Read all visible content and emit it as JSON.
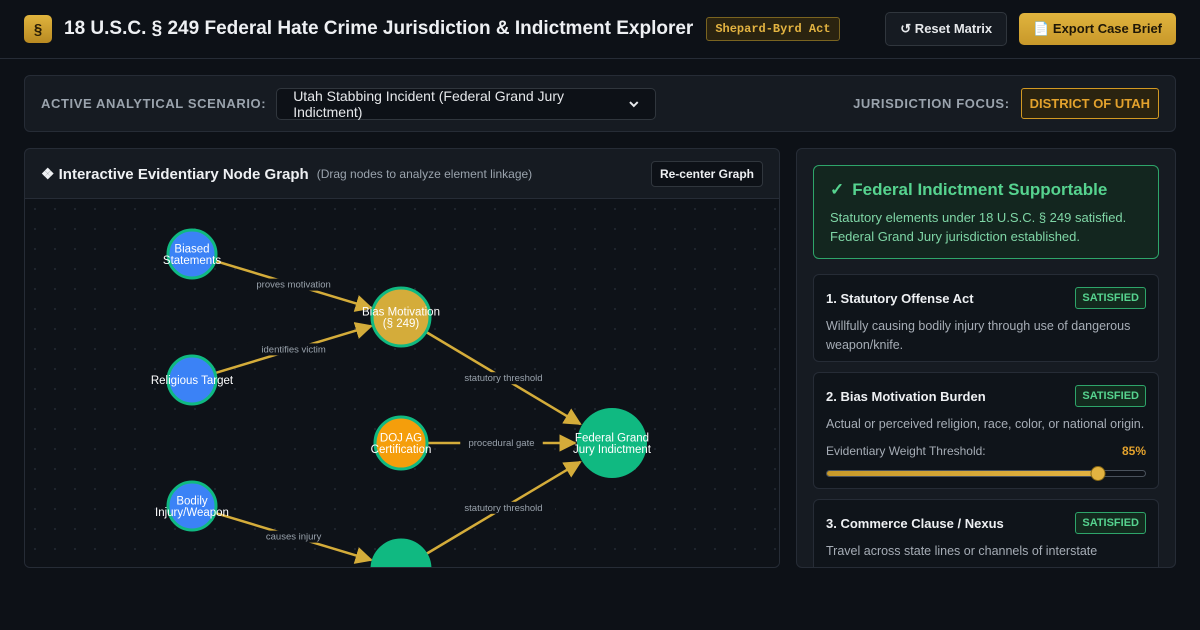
{
  "app": {
    "logo": "§",
    "title": "18 U.S.C. § 249 Federal Hate Crime Jurisdiction & Indictment Explorer",
    "act_badge": "Shepard-Byrd Act"
  },
  "toolbar": {
    "reset_label": "↺ Reset Matrix",
    "export_label": "📄 Export Case Brief"
  },
  "scenario": {
    "label": "ACTIVE ANALYTICAL SCENARIO:",
    "selected": "Utah Stabbing Incident (Federal Grand Jury Indictment)",
    "jurisdiction_label": "JURISDICTION FOCUS:",
    "jurisdiction_value": "DISTRICT OF UTAH"
  },
  "graph": {
    "title": "❖ Interactive Evidentiary Node Graph",
    "subtitle": "(Drag nodes to analyze element linkage)",
    "recenter_label": "Re-center Graph",
    "colors": {
      "evidence": "#3b82f6",
      "element": "#d4ac3a",
      "gate": "#f59e0b",
      "outcome": "#10b981",
      "edge": "#d4ac3a"
    },
    "nodes": [
      {
        "id": "biased-statements",
        "lines": [
          "Biased",
          "Statements"
        ],
        "kind": "evidence"
      },
      {
        "id": "religious-target",
        "lines": [
          "Religious Target"
        ],
        "kind": "evidence"
      },
      {
        "id": "bodily-injury",
        "lines": [
          "Bodily",
          "Injury/Weapon"
        ],
        "kind": "evidence"
      },
      {
        "id": "bias-motivation",
        "lines": [
          "Bias Motivation",
          "(§ 249)"
        ],
        "kind": "element"
      },
      {
        "id": "doj-ag",
        "lines": [
          "DOJ AG",
          "Certification"
        ],
        "kind": "gate"
      },
      {
        "id": "federal-grand-jury",
        "lines": [
          "Federal Grand",
          "Jury Indictment"
        ],
        "kind": "outcome"
      },
      {
        "id": "offense-act",
        "lines": [],
        "kind": "outcome"
      }
    ],
    "edges": [
      {
        "from": "biased-statements",
        "to": "bias-motivation",
        "label": "proves motivation"
      },
      {
        "from": "religious-target",
        "to": "bias-motivation",
        "label": "identifies victim"
      },
      {
        "from": "bias-motivation",
        "to": "federal-grand-jury",
        "label": "statutory threshold"
      },
      {
        "from": "doj-ag",
        "to": "federal-grand-jury",
        "label": "procedural gate"
      },
      {
        "from": "offense-act",
        "to": "federal-grand-jury",
        "label": "statutory threshold"
      },
      {
        "from": "bodily-injury",
        "to": "offense-act",
        "label": "causes injury"
      }
    ]
  },
  "verdict": {
    "icon": "✓",
    "title": "Federal Indictment Supportable",
    "text": "Statutory elements under 18 U.S.C. § 249 satisfied. Federal Grand Jury jurisdiction established."
  },
  "elements": [
    {
      "title": "1. Statutory Offense Act",
      "status": "SATISFIED",
      "text": "Willfully causing bodily injury through use of dangerous weapon/knife."
    },
    {
      "title": "2. Bias Motivation Burden",
      "status": "SATISFIED",
      "text": "Actual or perceived religion, race, color, or national origin.",
      "threshold_label": "Evidentiary Weight Threshold:",
      "threshold_value": "85%",
      "threshold_fraction": 0.85
    },
    {
      "title": "3. Commerce Clause / Nexus",
      "status": "SATISFIED",
      "text": "Travel across state lines or channels of interstate commerce."
    }
  ]
}
